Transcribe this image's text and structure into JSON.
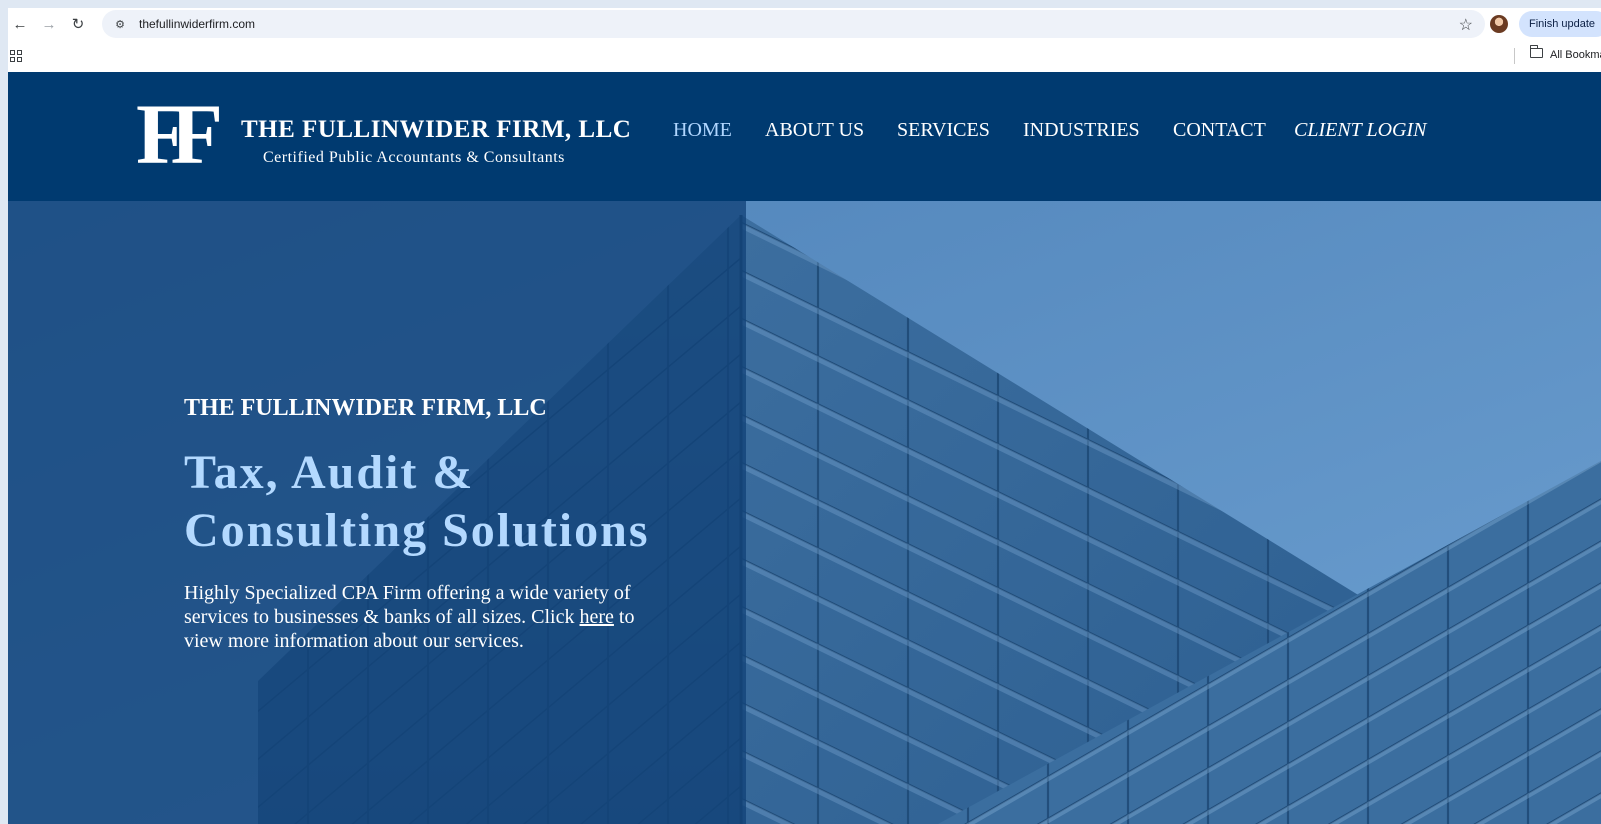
{
  "browser": {
    "url": "thefullinwiderfirm.com",
    "finish_update_label": "Finish update",
    "bookmarks_label": "All Bookmarks",
    "icons": [
      "back-arrow-icon",
      "forward-arrow-icon",
      "reload-icon",
      "site-settings-icon",
      "star-icon",
      "apps-grid-icon",
      "folder-icon",
      "kebab-menu-icon"
    ]
  },
  "header": {
    "logo_mark": "FF",
    "firm_name": "THE FULLINWIDER FIRM, LLC",
    "tagline": "Certified Public Accountants & Consultants",
    "nav": [
      {
        "label": "HOME",
        "active": true
      },
      {
        "label": "ABOUT US",
        "active": false
      },
      {
        "label": "SERVICES",
        "active": false
      },
      {
        "label": "INDUSTRIES",
        "active": false
      },
      {
        "label": "CONTACT",
        "active": false
      },
      {
        "label": "CLIENT LOGIN",
        "active": false
      }
    ]
  },
  "hero": {
    "eyebrow": "THE FULLINWIDER FIRM, LLC",
    "title_line1": "Tax, Audit &",
    "title_line2": "Consulting Solutions",
    "body_before": "Highly Specialized CPA Firm offering a wide variety of services to businesses & banks of all sizes. Click ",
    "body_link": "here",
    "body_after": " to view more information about our services."
  },
  "colors": {
    "header_bg": "#003a70",
    "nav_active": "#b0d6ff",
    "hero_title": "#b3d9ff",
    "sky": "#5b8fc2"
  }
}
